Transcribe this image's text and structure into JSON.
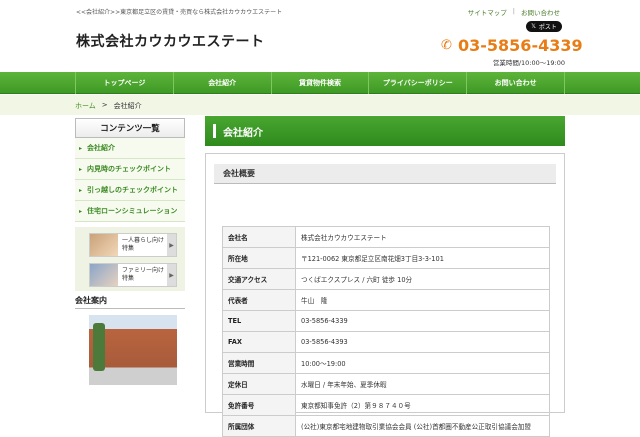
{
  "header": {
    "tagline": "<<会社紹介>>東京都足立区の賃貸・売買なら株式会社カウカウエステート",
    "sitemap": "サイトマップ",
    "contact": "お問い合わせ",
    "x_post": "ポスト",
    "logo": "株式会社カウカウエステート",
    "phone": "03-5856-4339",
    "hours": "営業時間/10:00～19:00"
  },
  "gnav": [
    "トップページ",
    "会社紹介",
    "賃貸物件検索",
    "プライバシーポリシー",
    "お問い合わせ"
  ],
  "breadcrumb": {
    "home": "ホーム",
    "sep": ">",
    "current": "会社紹介"
  },
  "sidebar": {
    "heading": "コンテンツ一覧",
    "items": [
      "会社紹介",
      "内見時のチェックポイント",
      "引っ越しのチェックポイント",
      "住宅ローンシミュレーション"
    ],
    "banners": [
      {
        "line1": "一人暮らし向け",
        "line2": "特集"
      },
      {
        "line1": "ファミリー向け",
        "line2": "特集"
      }
    ],
    "guide_heading": "会社案内"
  },
  "main": {
    "title": "会社紹介",
    "section": "会社概要",
    "rows": [
      {
        "k": "会社名",
        "v": "株式会社カウカウエステート"
      },
      {
        "k": "所在地",
        "v": "〒121-0062 東京都足立区南花畑3丁目3-3-101"
      },
      {
        "k": "交通アクセス",
        "v": "つくばエクスプレス / 六町 徒歩 10分"
      },
      {
        "k": "代表者",
        "v": "牛山　隆"
      },
      {
        "k": "TEL",
        "v": "03-5856-4339"
      },
      {
        "k": "FAX",
        "v": "03-5856-4393"
      },
      {
        "k": "営業時間",
        "v": "10:00～19:00"
      },
      {
        "k": "定休日",
        "v": "水曜日 / 年末年始、夏季休暇"
      },
      {
        "k": "免許番号",
        "v": "東京都知事免許（2）第９８７４０号"
      },
      {
        "k": "所属団体",
        "v": "(公社)東京都宅地建物取引業協会会員 (公社)首都圏不動産公正取引協議会加盟"
      }
    ]
  },
  "colors": {
    "brand_green": "#3e9a26",
    "phone_orange": "#e87d16"
  },
  "icons": {
    "phone": "phone-icon",
    "x_logo": "x-logo-icon"
  }
}
